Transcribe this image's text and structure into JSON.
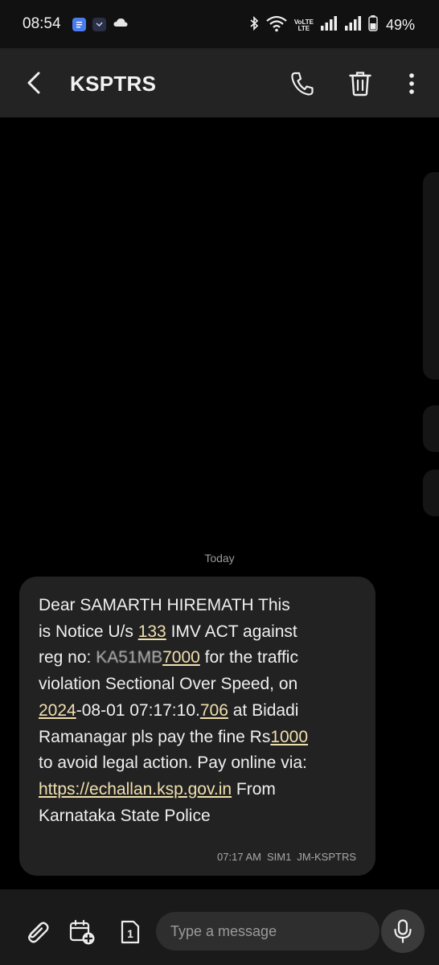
{
  "status_bar": {
    "time": "08:54",
    "volte_top": "VoLTE",
    "volte_bottom": "LTE",
    "battery": "49%",
    "icons": [
      "docs-icon",
      "app-icon",
      "cloud-icon",
      "bluetooth-icon",
      "wifi-icon",
      "volte-icon",
      "signal-icon",
      "signal-icon",
      "battery-icon"
    ]
  },
  "header": {
    "title": "KSPTRS",
    "actions": [
      "back-icon",
      "phone-icon",
      "trash-icon",
      "more-icon"
    ]
  },
  "conversation": {
    "date_label": "Today",
    "message": {
      "l1": "Dear SAMARTH HIREMATH This",
      "l2a": "is Notice U/s ",
      "l2link": "133",
      "l2b": " IMV ACT against",
      "l3a": "reg no: ",
      "l3blur": "KA51MB",
      "l3link": "7000",
      "l3b": " for the traffic",
      "l4": "violation Sectional Over Speed,  on",
      "l5link1": "2024",
      "l5a": "-08-01 07:17:10.",
      "l5link2": "706",
      "l5b": " at Bidadi",
      "l6a": "Ramanagar  pls pay the fine Rs",
      "l6link": "1000",
      "l7": "to avoid legal action. Pay online via:",
      "l8link": "https://echallan.ksp.gov.in",
      "l8b": " From",
      "l9": "Karnataka State Police",
      "time": "07:17 AM",
      "sim": "SIM1",
      "sender": "JM-KSPTRS"
    }
  },
  "composer": {
    "placeholder": "Type a message",
    "sim_number": "1"
  },
  "colors": {
    "link": "#f0dfae",
    "bubble": "#222222",
    "app_bar": "#232323",
    "docs_icon": "#4a7cf0"
  }
}
